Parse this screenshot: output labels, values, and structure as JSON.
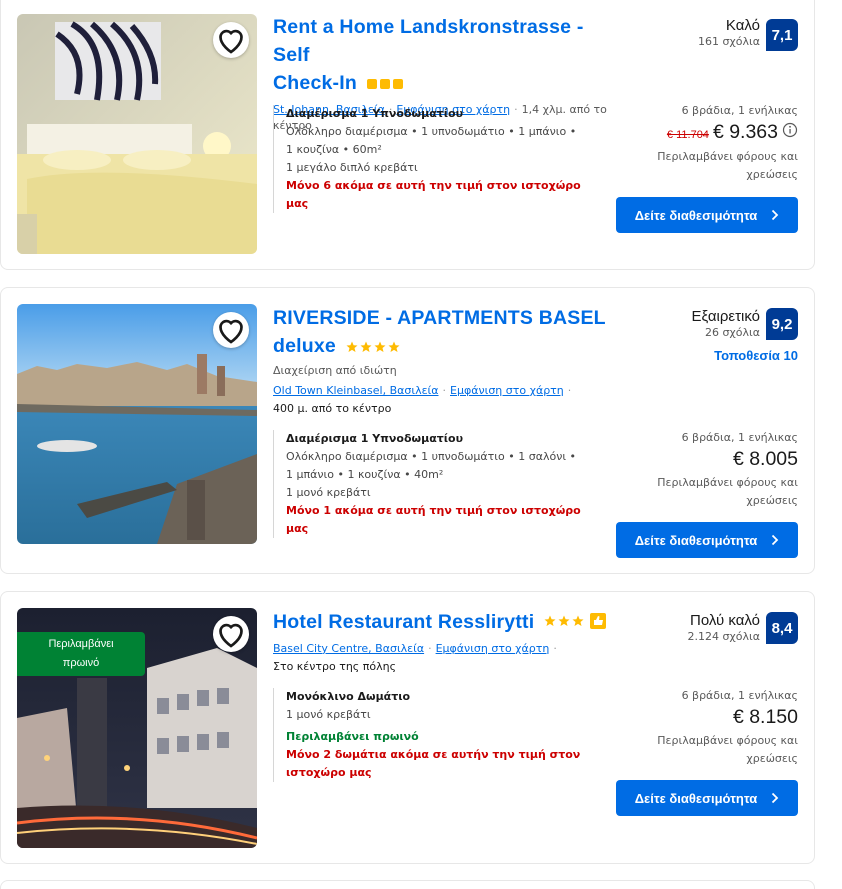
{
  "listings": [
    {
      "title_line1": "Rent a Home Landskronstrasse - Self",
      "title_line2": "Check-In",
      "location": "St. Johann, Βασιλεία",
      "map_link": "Εμφάνιση στο χάρτη",
      "distance": "1,4 χλμ. από το κέντρο",
      "room_title": "Διαμέρισμα 1 Υπνοδωματίου",
      "room_desc1": "Ολόκληρο διαμέρισμα • 1 υπνοδωμάτιο • 1 μπάνιο •",
      "room_desc2": "1 κουζίνα • 60m²",
      "bed": "1 μεγάλο διπλό κρεβάτι",
      "scarcity": "Μόνο 6 ακόμα σε αυτή την τιμή στον ιστοχώρο μας",
      "rating_word": "Καλό",
      "reviews": "161 σχόλια",
      "score": "7,1",
      "nights": "6 βράδια, 1 ενήλικας",
      "old_price": "€ 11.704",
      "price": "€ 9.363",
      "taxes1": "Περιλαμβάνει φόρους και",
      "taxes2": "χρεώσεις",
      "cta": "Δείτε διαθεσιμότητα"
    },
    {
      "title_line1": "RIVERSIDE - APARTMENTS BASEL",
      "title_line2": "deluxe",
      "managed": "Διαχείριση από ιδιώτη",
      "location": "Old Town Kleinbasel, Βασιλεία",
      "map_link": "Εμφάνιση στο χάρτη",
      "distance": "400 μ. από το κέντρο",
      "room_title": "Διαμέρισμα 1 Υπνοδωματίου",
      "room_desc1": "Ολόκληρο διαμέρισμα • 1 υπνοδωμάτιο • 1 σαλόνι •",
      "room_desc2": "1 μπάνιο • 1 κουζίνα • 40m²",
      "bed": "1 μονό κρεβάτι",
      "scarcity": "Μόνο 1 ακόμα σε αυτή την τιμή στον ιστοχώρο μας",
      "rating_word": "Εξαιρετικό",
      "reviews": "26 σχόλια",
      "score": "9,2",
      "location_score": "Τοποθεσία 10",
      "nights": "6 βράδια, 1 ενήλικας",
      "price": "€ 8.005",
      "taxes1": "Περιλαμβάνει φόρους και",
      "taxes2": "χρεώσεις",
      "cta": "Δείτε διαθεσιμότητα"
    },
    {
      "badge_line1": "Περιλαμβάνει",
      "badge_line2": "πρωινό",
      "title_line1": "Hotel Restaurant Resslirytti",
      "location": "Basel City Centre, Βασιλεία",
      "map_link": "Εμφάνιση στο χάρτη",
      "distance": "Στο κέντρο της πόλης",
      "room_title": "Μονόκλινο Δωμάτιο",
      "bed": "1 μονό κρεβάτι",
      "breakfast": "Περιλαμβάνει πρωινό",
      "scarcity1": "Μόνο 2 δωμάτια ακόμα σε αυτήν την τιμή στον",
      "scarcity2": "ιστοχώρο μας",
      "rating_word": "Πολύ καλό",
      "reviews": "2.124 σχόλια",
      "score": "8,4",
      "nights": "6 βράδια, 1 ενήλικας",
      "price": "€ 8.150",
      "taxes1": "Περιλαμβάνει φόρους και",
      "taxes2": "χρεώσεις",
      "cta": "Δείτε διαθεσιμότητα"
    }
  ],
  "colors": {
    "link_blue": "#006ce4",
    "score_navy": "#003b95",
    "scarcity_red": "#cc0000",
    "breakfast_green": "#008234",
    "star_yellow": "#febb02"
  },
  "icons": [
    "heart-icon",
    "star-icon",
    "square-rating-icon",
    "thumbs-up-icon",
    "info-icon",
    "chevron-right-icon"
  ]
}
